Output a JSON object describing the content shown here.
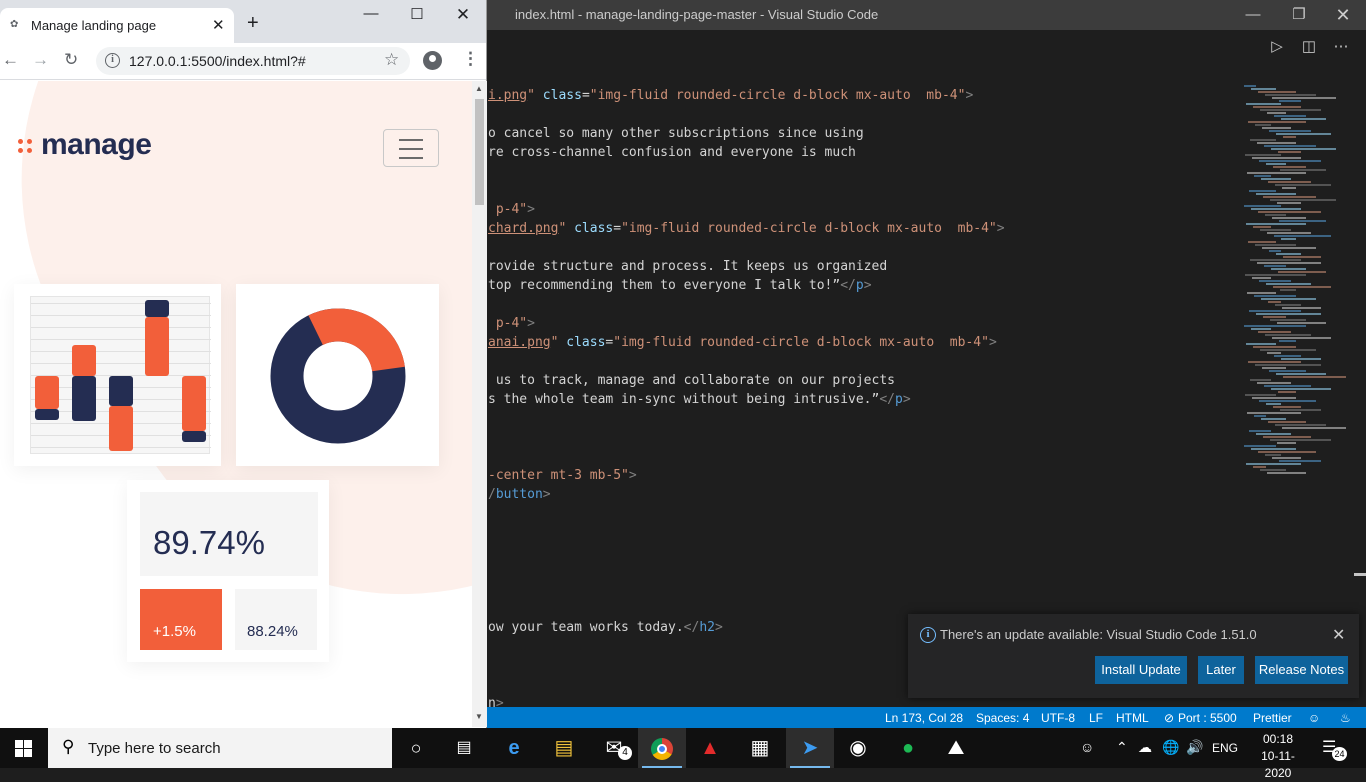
{
  "vscode": {
    "title": "index.html - manage-landing-page-master - Visual Studio Code",
    "code_lines": [
      [
        [
          "t-str t-ul",
          "i.png"
        ],
        [
          "t-str",
          "\""
        ],
        [
          "t-txt",
          " "
        ],
        [
          "t-attr",
          "class"
        ],
        [
          "t-txt",
          "="
        ],
        [
          "t-str",
          "\"img-fluid rounded-circle d-block mx-auto  mb-4\""
        ],
        [
          "t-tag",
          ">"
        ]
      ],
      [
        [
          "t-txt",
          "o cancel so many other subscriptions since using"
        ]
      ],
      [
        [
          "t-txt",
          "re cross-channel confusion and everyone is much"
        ]
      ],
      [
        [
          "t-str",
          " p-4\""
        ],
        [
          "t-tag",
          ">"
        ]
      ],
      [
        [
          "t-str t-ul",
          "chard.png"
        ],
        [
          "t-str",
          "\""
        ],
        [
          "t-txt",
          " "
        ],
        [
          "t-attr",
          "class"
        ],
        [
          "t-txt",
          "="
        ],
        [
          "t-str",
          "\"img-fluid rounded-circle d-block mx-auto  mb-4\""
        ],
        [
          "t-tag",
          ">"
        ]
      ],
      [
        [
          "t-txt",
          "rovide structure and process. It keeps us organized"
        ]
      ],
      [
        [
          "t-txt",
          "top recommending them to everyone I talk to!”"
        ],
        [
          "t-tag",
          "</"
        ],
        [
          "t-tagn",
          "p"
        ],
        [
          "t-tag",
          ">"
        ]
      ],
      [
        [
          "t-str",
          " p-4\""
        ],
        [
          "t-tag",
          ">"
        ]
      ],
      [
        [
          "t-str t-ul",
          "anai.png"
        ],
        [
          "t-str",
          "\""
        ],
        [
          "t-txt",
          " "
        ],
        [
          "t-attr",
          "class"
        ],
        [
          "t-txt",
          "="
        ],
        [
          "t-str",
          "\"img-fluid rounded-circle d-block mx-auto  mb-4\""
        ],
        [
          "t-tag",
          ">"
        ]
      ],
      [
        [
          "t-txt",
          " us to track, manage and collaborate on our projects"
        ]
      ],
      [
        [
          "t-txt",
          "s the whole team in-sync without being intrusive.”"
        ],
        [
          "t-tag",
          "</"
        ],
        [
          "t-tagn",
          "p"
        ],
        [
          "t-tag",
          ">"
        ]
      ],
      [
        [
          "t-str",
          "-center mt-3 mb-5\""
        ],
        [
          "t-tag",
          ">"
        ]
      ],
      [
        [
          "t-tag",
          "/"
        ],
        [
          "t-tagn",
          "button"
        ],
        [
          "t-tag",
          ">"
        ]
      ],
      [
        [
          "t-txt",
          "ow your team works today."
        ],
        [
          "t-tag",
          "</"
        ],
        [
          "t-tagn",
          "h2"
        ],
        [
          "t-tag",
          ">"
        ]
      ],
      [
        [
          "t-txt",
          "n"
        ],
        [
          "t-tag",
          ">"
        ]
      ]
    ],
    "notification": {
      "message": "There's an update available: Visual Studio Code 1.51.0",
      "install_label": "Install Update",
      "later_label": "Later",
      "notes_label": "Release Notes"
    },
    "status": {
      "position": "Ln 173, Col 28",
      "spaces": "Spaces: 4",
      "encoding": "UTF-8",
      "eol": "LF",
      "language": "HTML",
      "port": "Port : 5500",
      "formatter": "Prettier"
    },
    "colors": {
      "titlebar": "#3c3c3c",
      "editor": "#1e1e1e",
      "statusbar": "#007acc",
      "button": "#0e639c"
    }
  },
  "chrome": {
    "tab_title": "Manage landing page",
    "url": "127.0.0.1:5500/index.html?#"
  },
  "page": {
    "logo_text": "manage",
    "bar_chart": {
      "bars": [
        {
          "orange": 0.21,
          "navy": 0.07
        },
        {
          "orange": 0.21,
          "navy": 0.32
        },
        {
          "navy": 0.21,
          "orange": 0.32
        },
        {
          "navy": 0.11,
          "orange": 0.32
        },
        {
          "orange": 0.35,
          "navy": 0.07
        }
      ]
    },
    "donut": {
      "orange_fraction": 0.3,
      "navy_fraction": 0.7
    },
    "stat_main": "89.74%",
    "stat_positive": "+1.5%",
    "stat_secondary": "88.24%",
    "colors": {
      "orange": "#f25f3a",
      "navy": "#242d52",
      "background_tint": "#fdf0eb"
    }
  },
  "taskbar": {
    "search_placeholder": "Type here to search",
    "mail_badge": "4",
    "language": "ENG",
    "time": "00:18",
    "date": "10-11-2020",
    "notifications_count": "24"
  }
}
